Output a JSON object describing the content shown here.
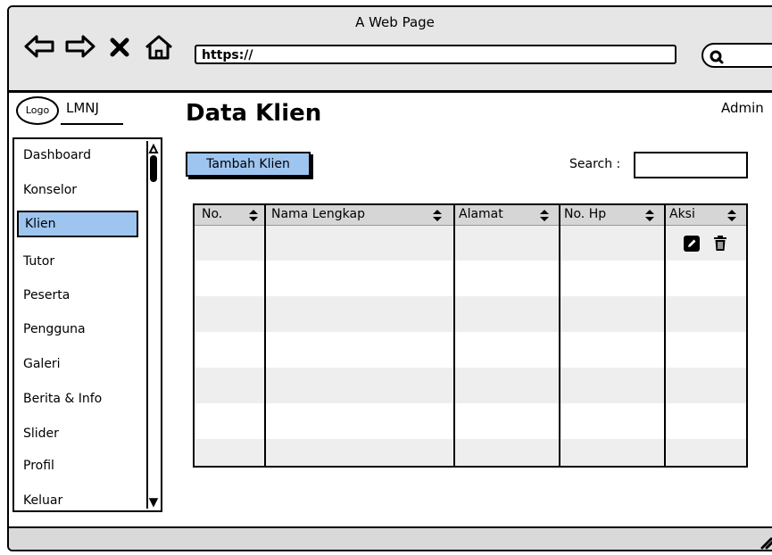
{
  "window": {
    "title": "A Web Page"
  },
  "browser": {
    "url": "https://",
    "nav_icons": [
      "back-arrow-icon",
      "forward-arrow-icon",
      "close-x-icon",
      "home-icon"
    ]
  },
  "header": {
    "logo_text": "Logo",
    "brand_name": "LMNJ",
    "user_label": "Admin",
    "page_title": "Data Klien"
  },
  "sidebar": {
    "items": [
      {
        "label": "Dashboard",
        "active": false
      },
      {
        "label": "Konselor",
        "active": false
      },
      {
        "label": "Klien",
        "active": true
      },
      {
        "label": "Tutor",
        "active": false
      },
      {
        "label": "Peserta",
        "active": false
      },
      {
        "label": "Pengguna",
        "active": false
      },
      {
        "label": "Galeri",
        "active": false
      },
      {
        "label": "Berita & Info",
        "active": false
      },
      {
        "label": "Slider",
        "active": false
      },
      {
        "label": "Profil",
        "active": false
      },
      {
        "label": "Keluar",
        "active": false
      }
    ]
  },
  "toolbar": {
    "add_button_label": "Tambah Klien",
    "search_label": "Search :"
  },
  "table": {
    "headers": [
      "No.",
      "Nama Lengkap",
      "Alamat",
      "No. Hp",
      "Aksi"
    ],
    "action_icons": [
      "edit-pencil-icon",
      "trash-icon"
    ]
  },
  "colors": {
    "accent": "#9ec5f0",
    "browser_bar": "#e6e6e6",
    "table_header": "#d6d6d6",
    "row_alt": "#eeeeee"
  }
}
